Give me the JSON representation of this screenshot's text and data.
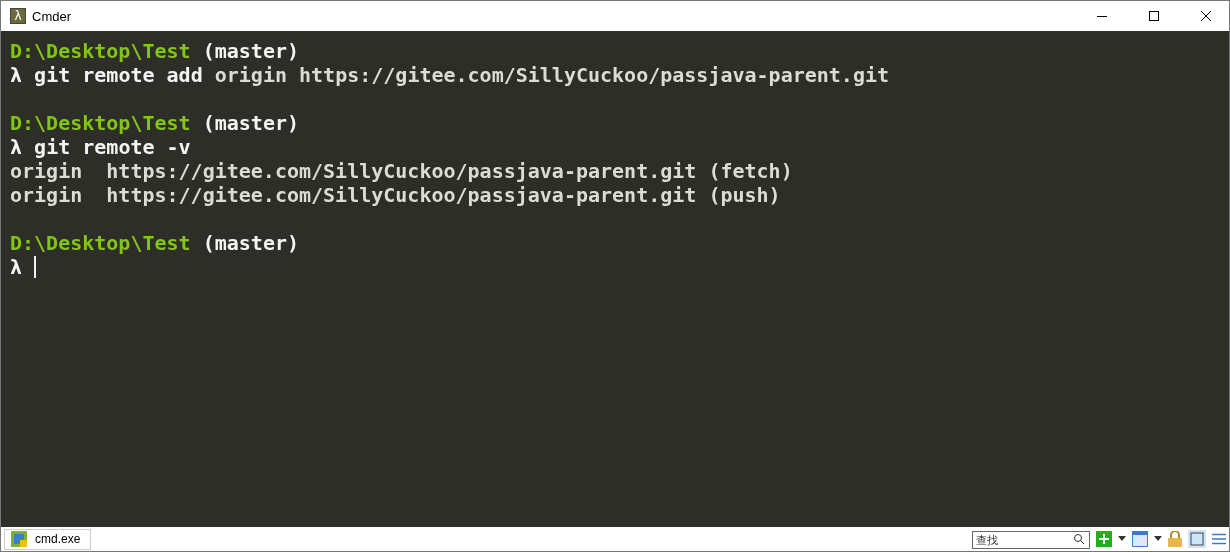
{
  "window": {
    "title": "Cmder",
    "icon_glyph": "λ"
  },
  "terminal": {
    "blocks": [
      {
        "path": "D:\\Desktop\\Test",
        "branch": "(master)",
        "prompt": "λ",
        "command": "git remote add",
        "args": "origin https://gitee.com/SillyCuckoo/passjava-parent.git"
      },
      {
        "path": "D:\\Desktop\\Test",
        "branch": "(master)",
        "prompt": "λ",
        "command": "git remote -v",
        "output": [
          "origin  https://gitee.com/SillyCuckoo/passjava-parent.git (fetch)",
          "origin  https://gitee.com/SillyCuckoo/passjava-parent.git (push)"
        ]
      },
      {
        "path": "D:\\Desktop\\Test",
        "branch": "(master)",
        "prompt": "λ",
        "cursor": true
      }
    ]
  },
  "status_bar": {
    "tabs": [
      {
        "label": "cmd.exe",
        "selected": true
      }
    ],
    "search": {
      "placeholder": "查找"
    }
  }
}
